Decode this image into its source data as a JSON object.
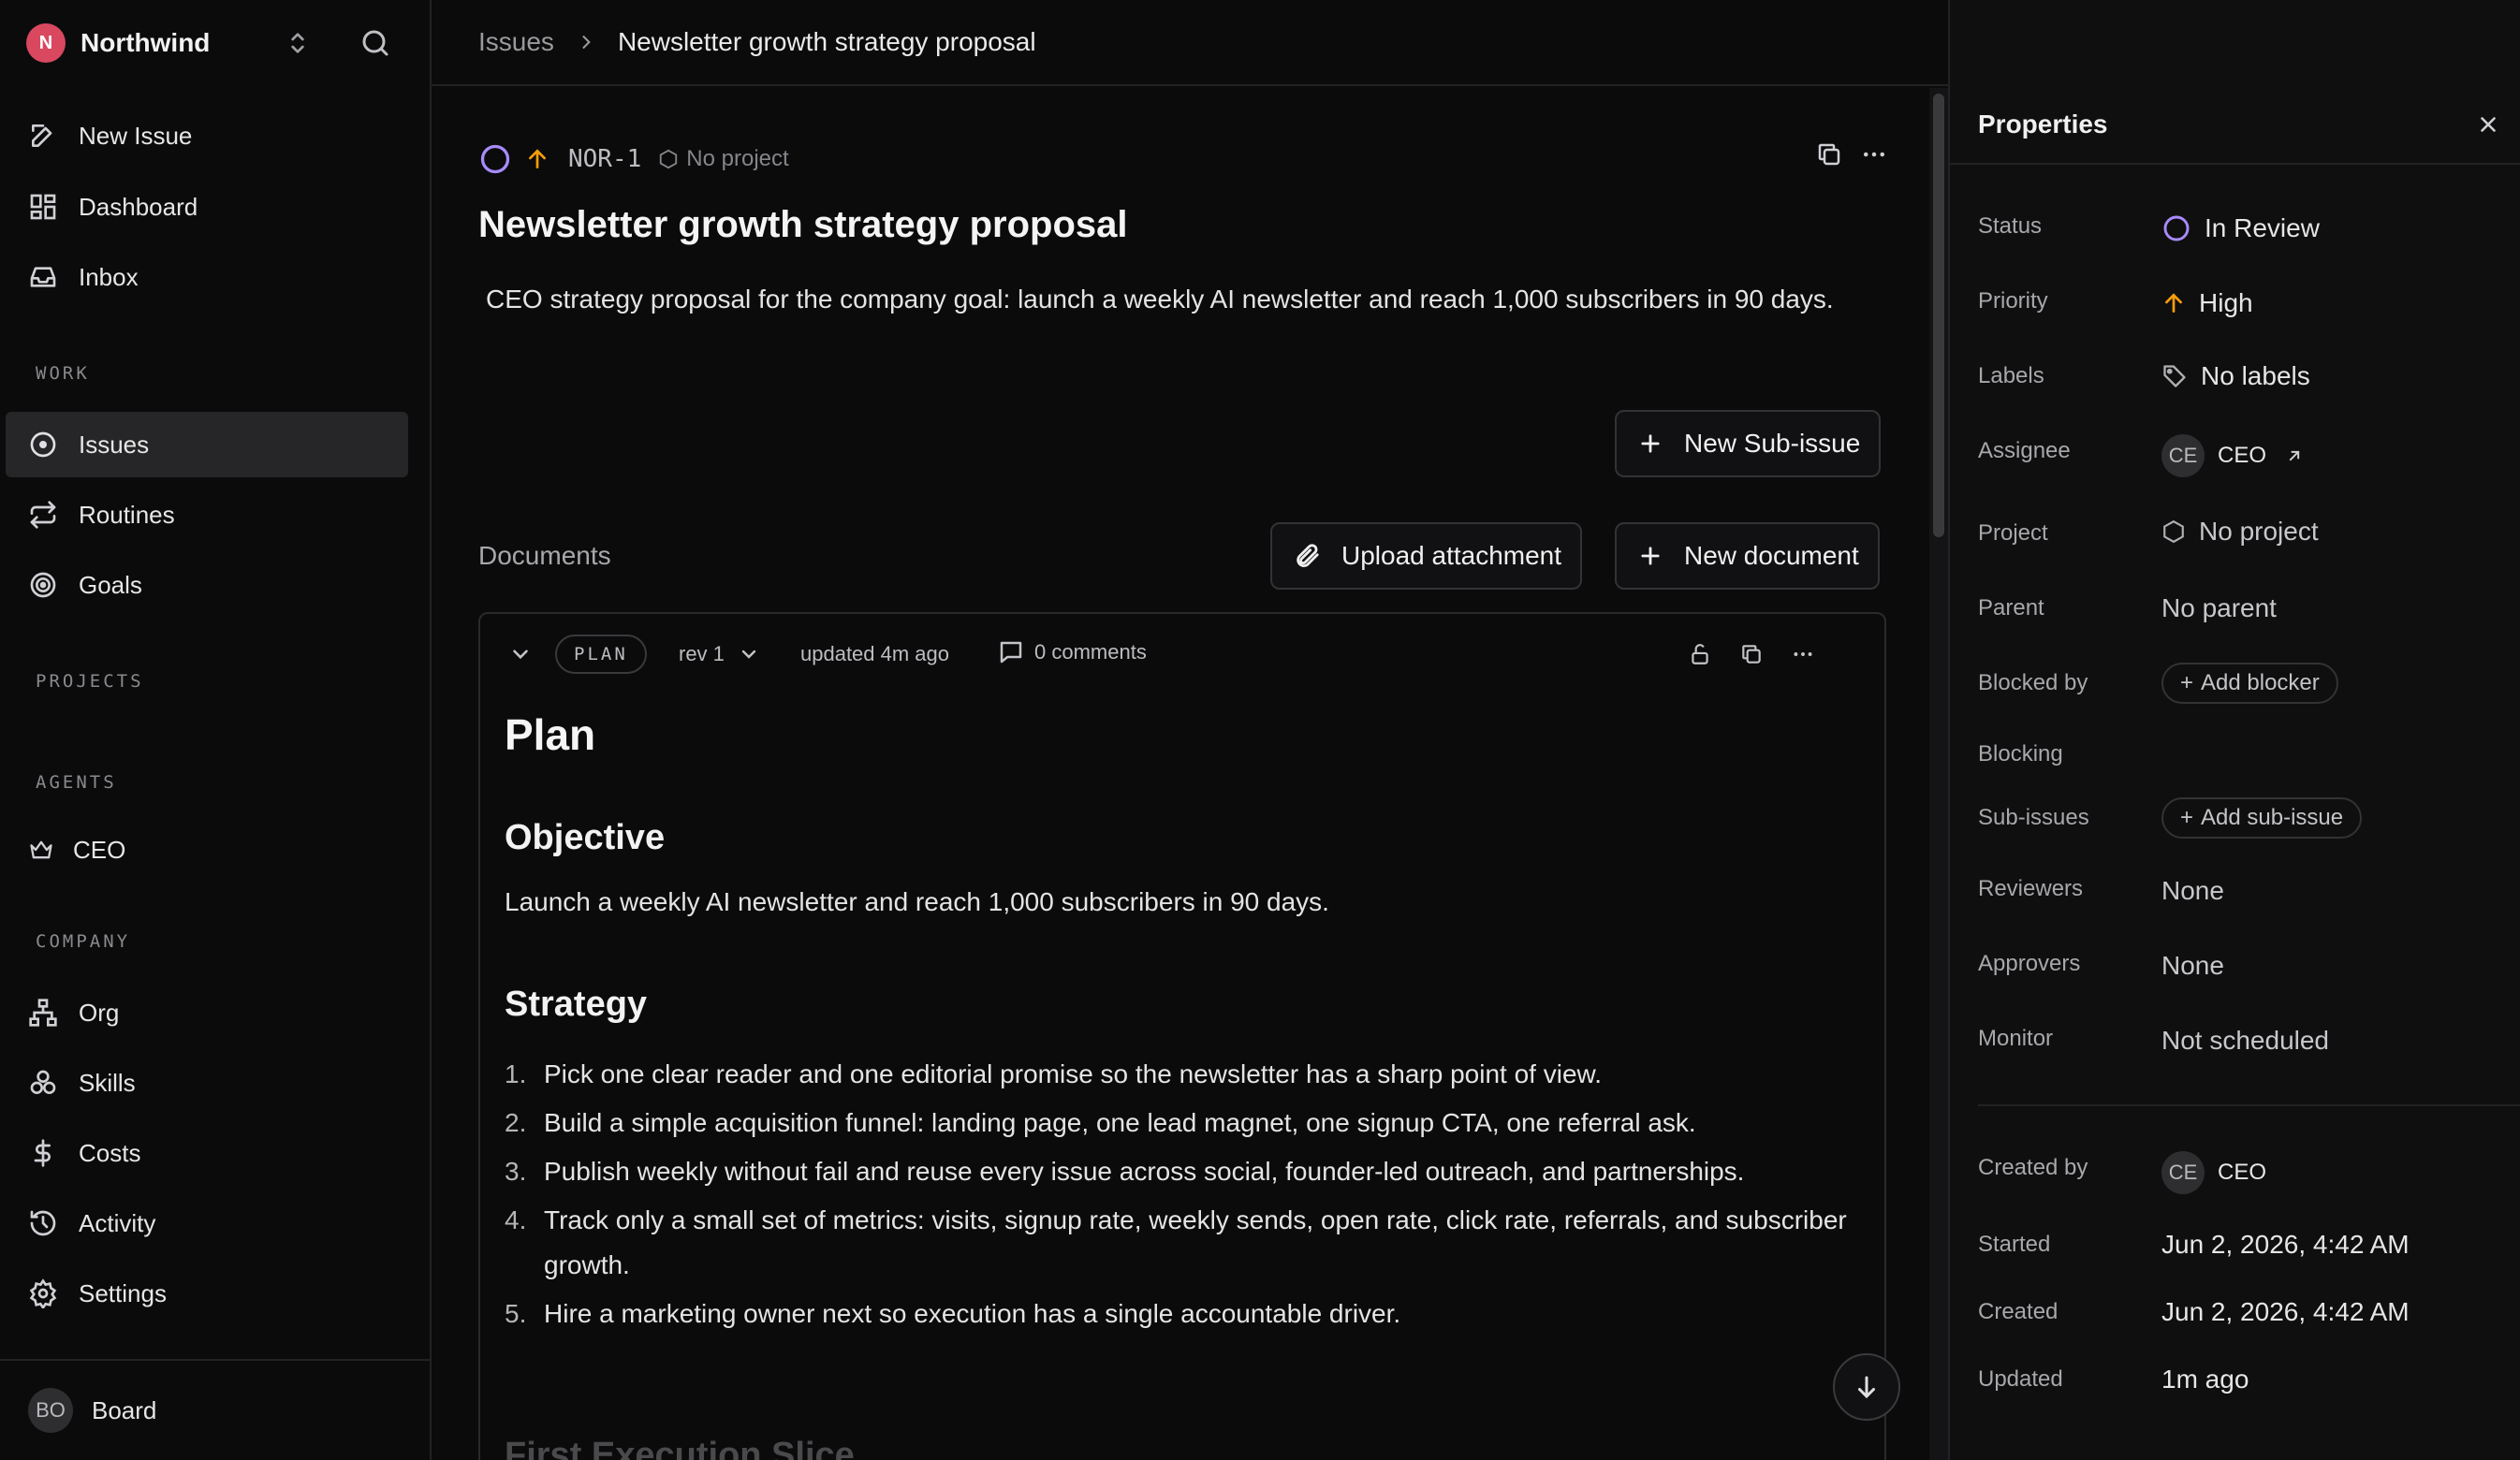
{
  "sidebar": {
    "workspace": {
      "initial": "N",
      "name": "Northwind"
    },
    "nav_top": [
      {
        "label": "New Issue"
      },
      {
        "label": "Dashboard"
      },
      {
        "label": "Inbox"
      }
    ],
    "work_label": "WORK",
    "work_items": [
      {
        "label": "Issues"
      },
      {
        "label": "Routines"
      },
      {
        "label": "Goals"
      }
    ],
    "projects_label": "PROJECTS",
    "agents_label": "AGENTS",
    "agents": [
      {
        "label": "CEO"
      }
    ],
    "company_label": "COMPANY",
    "company_items": [
      {
        "label": "Org"
      },
      {
        "label": "Skills"
      },
      {
        "label": "Costs"
      },
      {
        "label": "Activity"
      },
      {
        "label": "Settings"
      }
    ],
    "user": {
      "initials": "BO",
      "name": "Board"
    }
  },
  "breadcrumb": {
    "parent": "Issues",
    "current": "Newsletter growth strategy proposal"
  },
  "issue": {
    "id": "NOR-1",
    "project": "No project",
    "title": "Newsletter growth strategy proposal",
    "description": "CEO strategy proposal for the company goal: launch a weekly AI newsletter and reach 1,000 subscribers in 90 days.",
    "new_subissue_label": "New Sub-issue",
    "documents_label": "Documents",
    "upload_label": "Upload attachment",
    "new_document_label": "New document"
  },
  "document": {
    "key": "PLAN",
    "rev": "rev 1",
    "updated": "updated 4m ago",
    "comments": "0 comments",
    "h1": "Plan",
    "objective_heading": "Objective",
    "objective_text": "Launch a weekly AI newsletter and reach 1,000 subscribers in 90 days.",
    "strategy_heading": "Strategy",
    "strategy_items": [
      {
        "num": "1.",
        "text": "Pick one clear reader and one editorial promise so the newsletter has a sharp point of view."
      },
      {
        "num": "2.",
        "text": "Build a simple acquisition funnel: landing page, one lead magnet, one signup CTA, one referral ask."
      },
      {
        "num": "3.",
        "text": "Publish weekly without fail and reuse every issue across social, founder-led outreach, and partnerships."
      },
      {
        "num": "4.",
        "text": "Track only a small set of metrics: visits, signup rate, weekly sends, open rate, click rate, referrals, and subscriber growth."
      },
      {
        "num": "5.",
        "text": "Hire a marketing owner next so execution has a single accountable driver."
      }
    ],
    "next_heading": "First Execution Slice"
  },
  "properties": {
    "title": "Properties",
    "status_label": "Status",
    "status_value": "In Review",
    "priority_label": "Priority",
    "priority_value": "High",
    "labels_label": "Labels",
    "labels_value": "No labels",
    "assignee_label": "Assignee",
    "assignee_initials": "CE",
    "assignee_value": "CEO",
    "project_label": "Project",
    "project_value": "No project",
    "parent_label": "Parent",
    "parent_value": "No parent",
    "blocked_by_label": "Blocked by",
    "add_blocker": "Add blocker",
    "blocking_label": "Blocking",
    "subissues_label": "Sub-issues",
    "add_subissue": "Add sub-issue",
    "reviewers_label": "Reviewers",
    "reviewers_value": "None",
    "approvers_label": "Approvers",
    "approvers_value": "None",
    "monitor_label": "Monitor",
    "monitor_value": "Not scheduled",
    "created_by_label": "Created by",
    "created_by_initials": "CE",
    "created_by_value": "CEO",
    "started_label": "Started",
    "started_value": "Jun 2, 2026, 4:42 AM",
    "created_label": "Created",
    "created_value": "Jun 2, 2026, 4:42 AM",
    "updated_label": "Updated",
    "updated_value": "1m ago"
  },
  "colors": {
    "status_in_review": "#a78bfa",
    "priority_high": "#f59e0b",
    "brand": "#d9485f"
  }
}
